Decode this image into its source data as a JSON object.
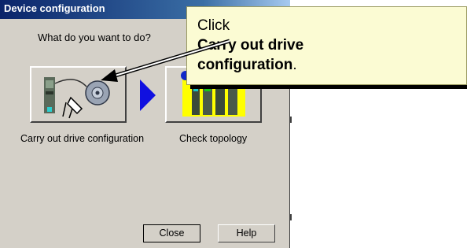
{
  "dialog": {
    "title": "Device configuration",
    "question": "What do you want to do?",
    "options": [
      {
        "label": "Carry out drive configuration",
        "icon": "drive-configuration-icon"
      },
      {
        "label": "Check topology",
        "icon": "topology-icon"
      }
    ],
    "buttons": {
      "close": "Close",
      "help": "Help"
    },
    "colors": {
      "titlebar": "#0a246a",
      "face": "#d4d0c8",
      "arrow": "#1010e0",
      "highlight": "#ffff00"
    }
  },
  "callout": {
    "line1": "Click",
    "line2": "Carry out drive",
    "line3_bold": "configuration",
    "line3_tail": ".",
    "background": "#fbfbd3"
  }
}
